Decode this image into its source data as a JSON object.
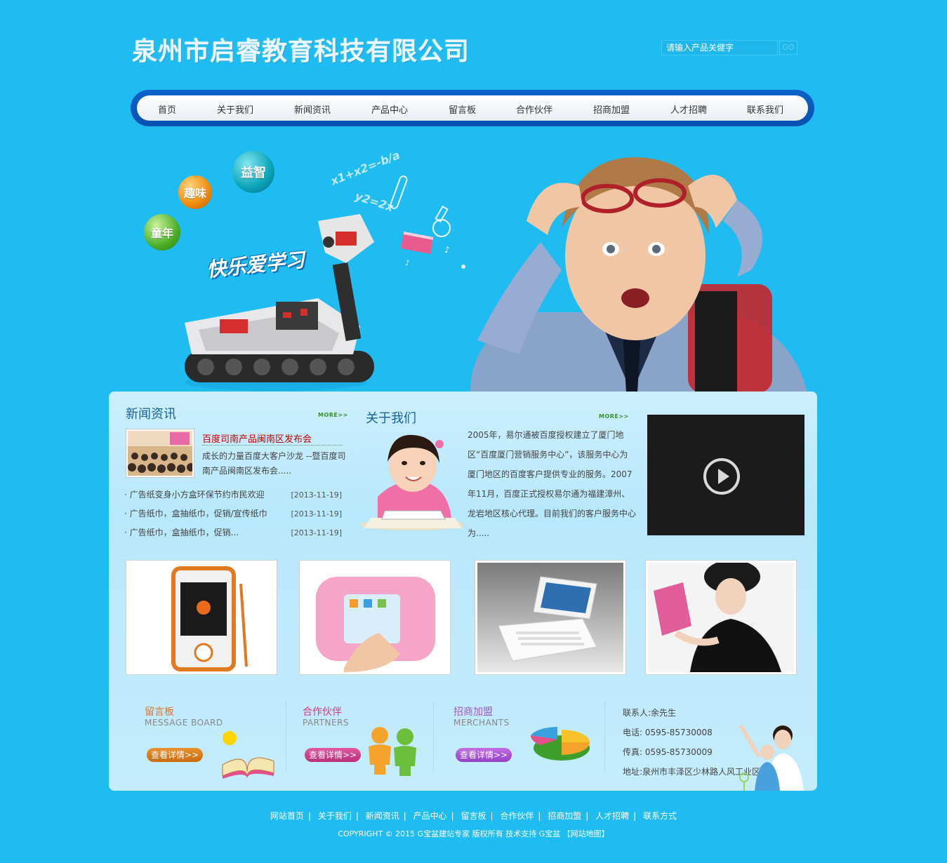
{
  "header": {
    "title": "泉州市启睿教育科技有限公司",
    "search_placeholder": "请输入产品关健字",
    "search_button": "GO"
  },
  "nav": {
    "items": [
      "首页",
      "关于我们",
      "新闻资讯",
      "产品中心",
      "留言板",
      "合作伙伴",
      "招商加盟",
      "人才招聘",
      "联系我们"
    ]
  },
  "hero": {
    "balls": [
      "益智",
      "趣味",
      "童年"
    ],
    "slogan": "快乐爱学习",
    "formula1": "x1+x2=-b/a",
    "formula2": "y2=2x"
  },
  "news": {
    "title": "新闻资讯",
    "more": "MORE>>",
    "headline": "百度司南产品闽南区发布会",
    "summary": "成长的力量百度大客户沙龙 --暨百度司南产品闽南区发布会.....",
    "list": [
      {
        "text": "广告纸变身小方盒环保节约市民欢迎",
        "date": "[2013-11-19]"
      },
      {
        "text": "广告纸巾，盒抽纸巾，促销/宣传纸巾",
        "date": "[2013-11-19]"
      },
      {
        "text": "广告纸巾，盒抽纸巾，促销...",
        "date": "[2013-11-19]"
      }
    ]
  },
  "about": {
    "title": "关于我们",
    "more": "MORE>>",
    "text": "2005年，易尔通被百度授权建立了厦门地区“百度厦门营销服务中心”，该服务中心为厦门地区的百度客户提供专业的服务。2007年11月，百度正式授权易尔通为福建漳州、龙岩地区核心代理。目前我们的客户服务中心为....."
  },
  "bottom": {
    "message": {
      "title": "留言板",
      "sub": "MESSAGE BOARD",
      "button": "查看详情>>"
    },
    "partners": {
      "title": "合作伙伴",
      "sub": "PARTNERS",
      "button": "查看详情>>"
    },
    "merchants": {
      "title": "招商加盟",
      "sub": "MERCHANTS",
      "button": "查看详情>>"
    },
    "contact": {
      "person": "联系人:余先生",
      "phone": "电话:  0595-85730008",
      "fax": "传真:  0595-85730009",
      "address": "地址:泉州市丰泽区少林路人风工业区"
    }
  },
  "footer": {
    "links": [
      "网站首页",
      "关于我们",
      "新闻资讯",
      "产品中心",
      "留言板",
      "合作伙伴",
      "招商加盟",
      "人才招聘",
      "联系方式"
    ],
    "copyright": "COPYRIGHT © 2015 G宝盆建站专家 版权所有 技术支持 G宝盆 【网站地图】"
  },
  "colors": {
    "background": "#1fbcf2",
    "nav_border": "#0b63c8",
    "headline_red": "#c00000",
    "section_title": "#1a5f9c",
    "bottom_title": "#e0742d"
  }
}
